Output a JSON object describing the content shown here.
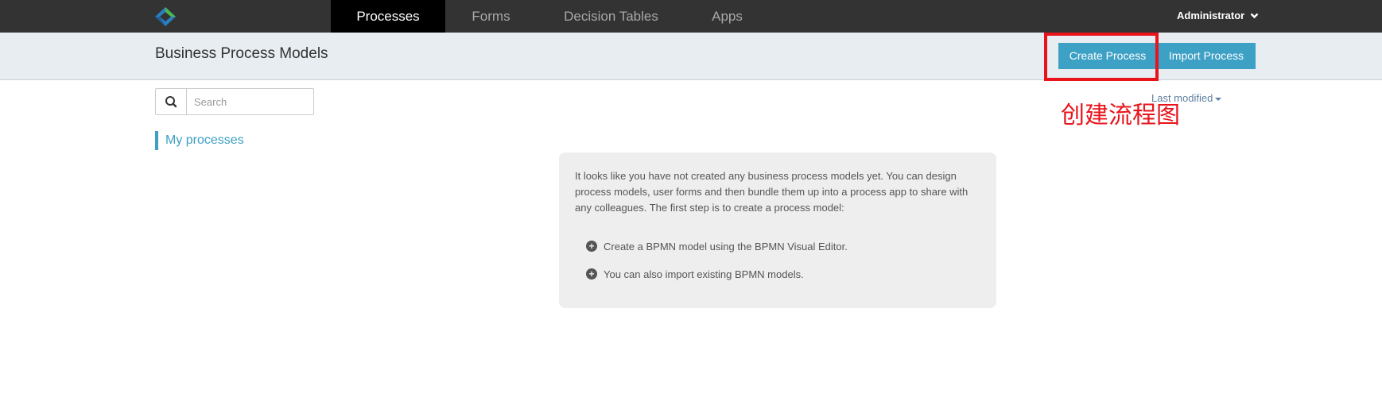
{
  "nav": {
    "tabs": [
      {
        "label": "Processes",
        "active": true
      },
      {
        "label": "Forms",
        "active": false
      },
      {
        "label": "Decision Tables",
        "active": false
      },
      {
        "label": "Apps",
        "active": false
      }
    ],
    "user_menu_label": "Administrator",
    "user_menu_icon": "chevron-down-icon"
  },
  "header": {
    "title": "Business Process Models",
    "create_label": "Create Process",
    "import_label": "Import Process"
  },
  "sidebar": {
    "search_placeholder": "Search",
    "search_icon": "search-icon",
    "filter_label": "My processes"
  },
  "sort": {
    "label": "Last modified"
  },
  "empty_state": {
    "intro": "It looks like you have not created any business process models yet. You can design process models, user forms and then bundle them up into a process app to share with any colleagues. The first step is to create a process model:",
    "hints": [
      "Create a BPMN model using the BPMN Visual Editor.",
      "You can also import existing BPMN models."
    ]
  },
  "annotation": {
    "text": "创建流程图"
  },
  "colors": {
    "topbar": "#333333",
    "accent": "#3da0c5",
    "annotation_red": "#e8141c",
    "subheader_bg": "#e8edf1"
  }
}
